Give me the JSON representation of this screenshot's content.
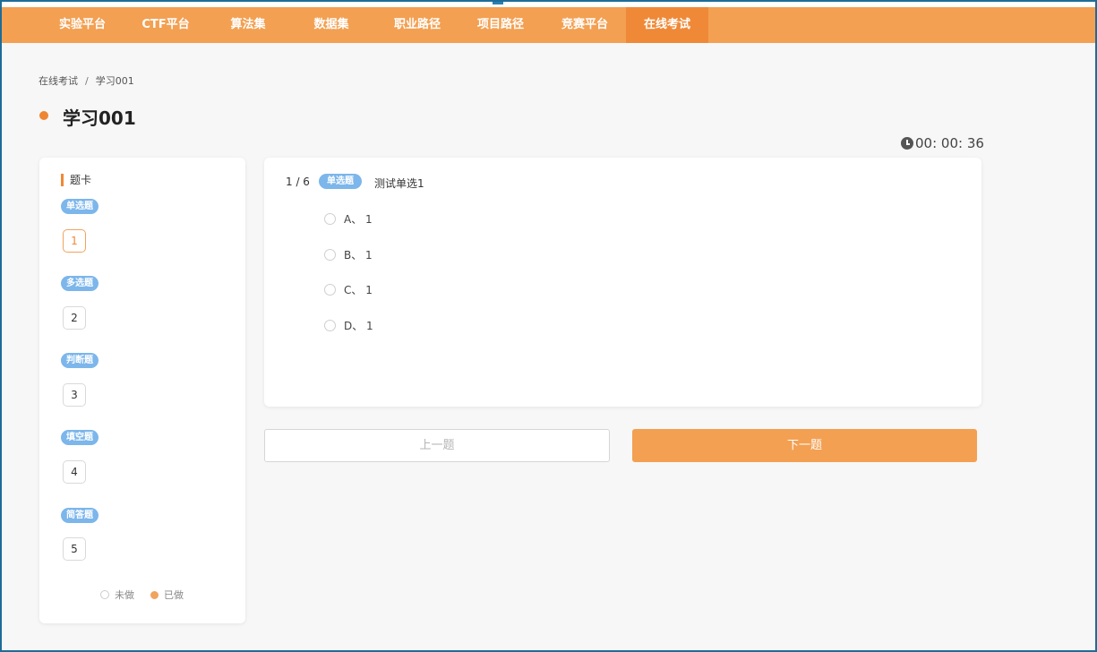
{
  "nav": {
    "items": [
      "实验平台",
      "CTF平台",
      "算法集",
      "数据集",
      "职业路径",
      "项目路径",
      "竞赛平台",
      "在线考试"
    ],
    "active_index": 7
  },
  "breadcrumb": {
    "parent": "在线考试",
    "separator": "/",
    "current": "学习001"
  },
  "page_title": "学习001",
  "timer": "00: 00: 36",
  "answer_card": {
    "title": "题卡",
    "groups": [
      {
        "type": "单选题",
        "numbers": [
          "1"
        ]
      },
      {
        "type": "多选题",
        "numbers": [
          "2"
        ]
      },
      {
        "type": "判断题",
        "numbers": [
          "3"
        ]
      },
      {
        "type": "填空题",
        "numbers": [
          "4"
        ]
      },
      {
        "type": "简答题",
        "numbers": [
          "5"
        ]
      }
    ],
    "legend": {
      "undone": "未做",
      "done": "已做"
    }
  },
  "question": {
    "progress": "1 / 6",
    "type": "单选题",
    "text": "测试单选1",
    "options": [
      "A、 1",
      "B、 1",
      "C、 1",
      "D、 1"
    ]
  },
  "buttons": {
    "prev": "上一题",
    "next": "下一题"
  },
  "colors": {
    "nav_bg": "#f3a052",
    "nav_active": "#ef8937",
    "badge": "#7cb6eb",
    "frame_border": "#1d6c97"
  }
}
